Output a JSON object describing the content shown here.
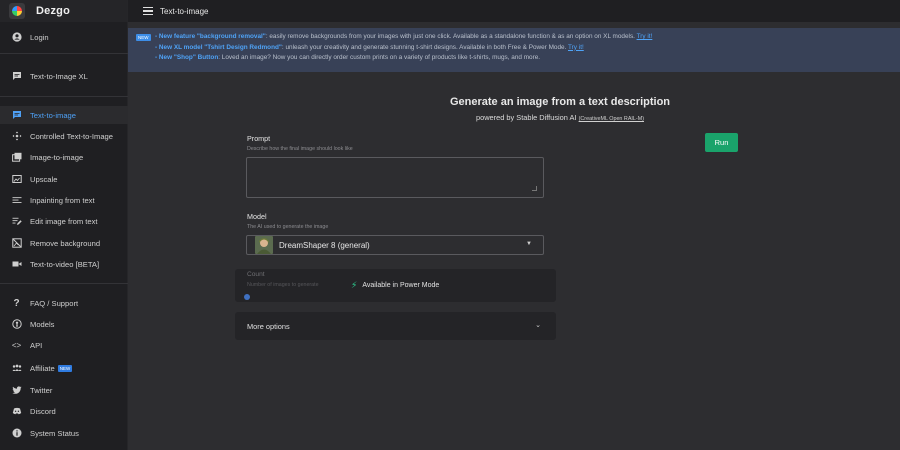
{
  "app": {
    "name": "Dezgo",
    "page_title": "Text-to-image"
  },
  "sidebar": {
    "items": [
      {
        "label": "Login",
        "icon": "account-circle-icon"
      },
      {
        "label": "Text-to-Image XL",
        "icon": "message-icon"
      },
      {
        "label": "Text-to-image",
        "icon": "message-icon",
        "active": true
      },
      {
        "label": "Controlled Text-to-Image",
        "icon": "move-icon"
      },
      {
        "label": "Image-to-image",
        "icon": "image-stack-icon"
      },
      {
        "label": "Upscale",
        "icon": "upscale-icon"
      },
      {
        "label": "Inpainting from text",
        "icon": "inpaint-icon"
      },
      {
        "label": "Edit image from text",
        "icon": "edit-lines-icon"
      },
      {
        "label": "Remove background",
        "icon": "remove-bg-icon"
      },
      {
        "label": "Text-to-video [BETA]",
        "icon": "video-icon"
      },
      {
        "label": "FAQ / Support",
        "icon": "question-icon"
      },
      {
        "label": "Models",
        "icon": "models-icon"
      },
      {
        "label": "API",
        "icon": "code-icon"
      },
      {
        "label": "Affiliate",
        "icon": "affiliate-icon",
        "badge": "NEW"
      },
      {
        "label": "Twitter",
        "icon": "twitter-icon"
      },
      {
        "label": "Discord",
        "icon": "discord-icon"
      },
      {
        "label": "System Status",
        "icon": "info-icon"
      }
    ]
  },
  "announcement": {
    "badge": "NEW",
    "lines": [
      {
        "prefix": "- New feature ",
        "highlight": "\"background removal\"",
        "text": ": easily remove backgrounds from your images with just one click. Available as a standalone function & as an option on XL models. ",
        "link": "Try it!"
      },
      {
        "prefix": "- New XL model ",
        "highlight": "\"Tshirt Design Redmond\"",
        "text": ": unleash your creativity and generate stunning t-shirt designs. Available in both Free & Power Mode. ",
        "link": "Try it!"
      },
      {
        "prefix": "- New ",
        "highlight": "\"Shop\" Button",
        "text": ": Loved an image? Now you can directly order custom prints on a variety of products like t-shirts, mugs, and more.",
        "link": ""
      }
    ]
  },
  "main": {
    "heading": "Generate an image from a text description",
    "subheading": "powered by Stable Diffusion AI",
    "license_link": "(CreativeML Open RAIL-M)",
    "run_label": "Run",
    "prompt": {
      "label": "Prompt",
      "help": "Describe how the final image should look like",
      "value": ""
    },
    "model": {
      "label": "Model",
      "help": "The AI used to generate the image",
      "selected": "DreamShaper 8 (general)"
    },
    "count": {
      "label": "Count",
      "help": "Number of images to generate",
      "power_mode": "Available in Power Mode"
    },
    "more_options": "More options"
  },
  "colors": {
    "accent": "#4ea0f5",
    "run": "#1aa36b",
    "banner": "#384157"
  }
}
